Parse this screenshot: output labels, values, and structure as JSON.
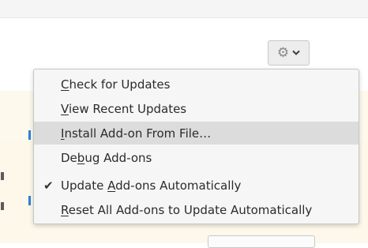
{
  "toolbar": {
    "gear_icon": "gear-icon",
    "chevron_icon": "chevron-down-icon"
  },
  "menu": {
    "items": [
      {
        "label": "Check for Updates",
        "mnemonic_index": 0,
        "checked": false,
        "hovered": false
      },
      {
        "label": "View Recent Updates",
        "mnemonic_index": 0,
        "checked": false,
        "hovered": false
      },
      {
        "label": "Install Add-on From File…",
        "mnemonic_index": 0,
        "checked": false,
        "hovered": true
      },
      {
        "label": "Debug Add-ons",
        "mnemonic_index": 2,
        "checked": false,
        "hovered": false
      },
      {
        "label": "Update Add-ons Automatically",
        "mnemonic_index": 7,
        "checked": true,
        "hovered": false
      },
      {
        "label": "Reset All Add-ons to Update Automatically",
        "mnemonic_index": 0,
        "checked": false,
        "hovered": false
      }
    ],
    "check_icon": "checkmark-icon"
  },
  "colors": {
    "menu_bg": "#f6f6f6",
    "hover_bg": "#dcdcdc",
    "panel_bg": "#fdf9ed",
    "link_blue": "#2f7fd6"
  }
}
